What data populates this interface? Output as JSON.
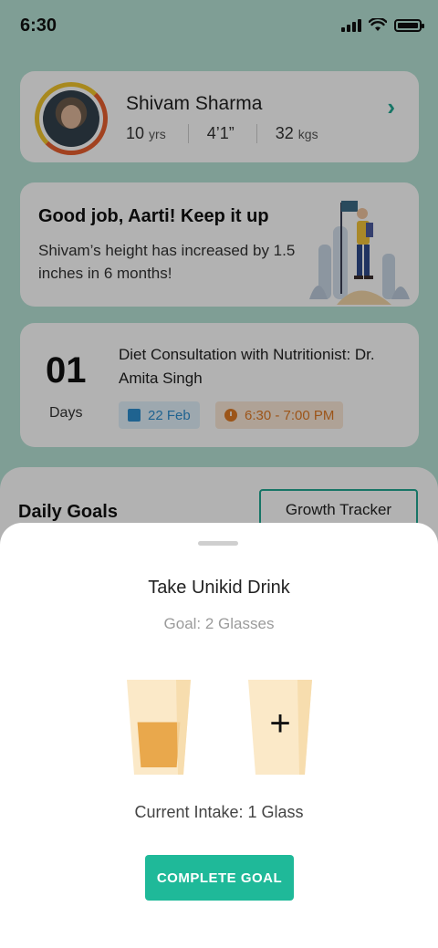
{
  "status_bar": {
    "time": "6:30"
  },
  "profile": {
    "name": "Shivam Sharma",
    "age_value": "10",
    "age_unit": "yrs",
    "height": "4’1”",
    "weight_value": "32",
    "weight_unit": "kgs"
  },
  "congrats": {
    "title": "Good job, Aarti! Keep it up",
    "message": "Shivam’s height has increased by 1.5 inches in 6 months!"
  },
  "appointment": {
    "days_count": "01",
    "days_label": "Days",
    "title": "Diet Consultation with Nutritionist: Dr. Amita Singh",
    "date": "22 Feb",
    "time": "6:30 - 7:00 PM"
  },
  "daily_goals": {
    "title": "Daily Goals",
    "growth_tracker_label": "Growth Tracker"
  },
  "modal": {
    "title": "Take Unikid Drink",
    "goal_text": "Goal: 2 Glasses",
    "glass_1_fill_fraction": 0.55,
    "glass_2_fill_fraction": 0,
    "add_symbol": "+",
    "intake_text": "Current Intake: 1 Glass",
    "complete_label": "COMPLETE GOAL"
  },
  "colors": {
    "accent": "#1fb999",
    "background_teal": "#b7e3d6",
    "date_chip": "#2d8ecf",
    "time_chip": "#e07a25",
    "glass_fill": "#e9a84c"
  }
}
